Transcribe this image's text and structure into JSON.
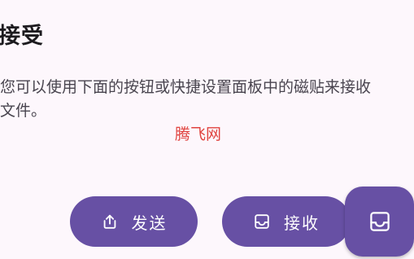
{
  "section": {
    "title": "接受",
    "description_line1": "您可以使用下面的按钮或快捷设置面板中的磁贴来接收",
    "description_line2": "文件。"
  },
  "watermark": "腾飞网",
  "actions": {
    "send": {
      "label": "发送",
      "icon": "share-upload-icon"
    },
    "receive": {
      "label": "接收",
      "icon": "inbox-tray-icon"
    },
    "fab": {
      "icon": "inbox-tray-icon"
    }
  },
  "colors": {
    "background": "#fdf7fc",
    "accent": "#6750a4",
    "on_accent": "#ffffff",
    "title_text": "#1d1b1f",
    "body_text": "#49454f",
    "watermark": "#e0433f"
  }
}
